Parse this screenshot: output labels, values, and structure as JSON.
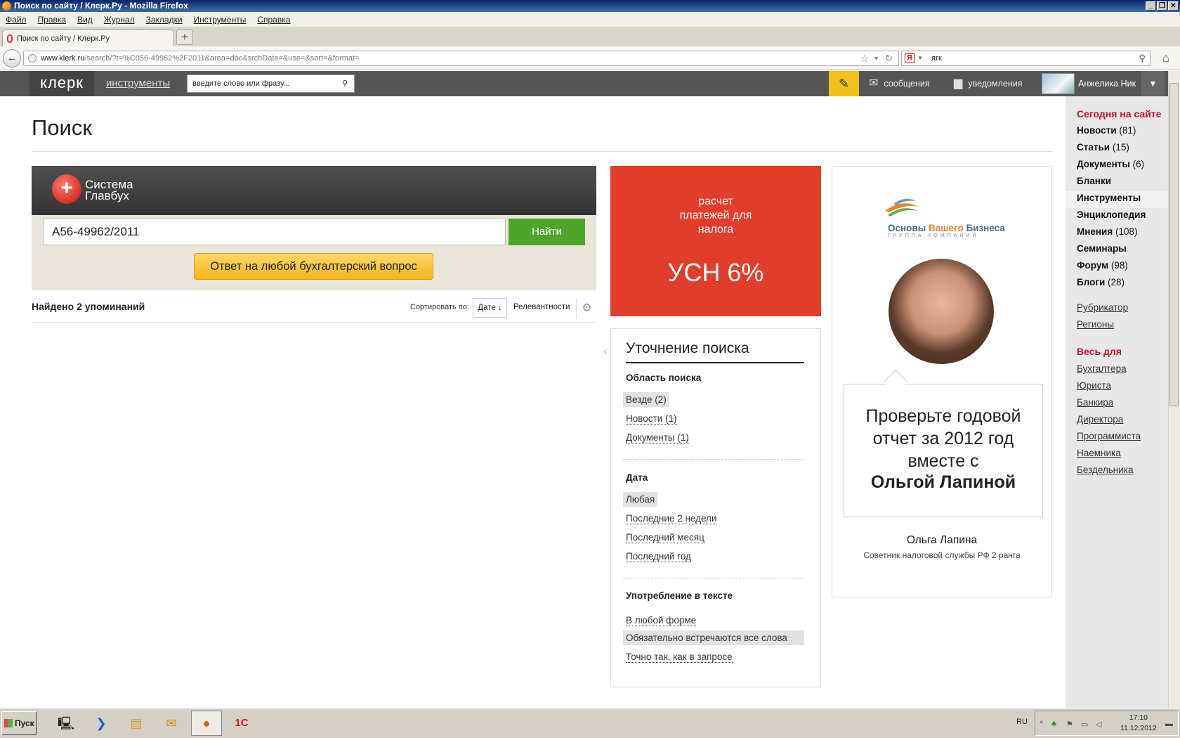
{
  "window": {
    "title": "Поиск по сайту / Клерк.Ру - Mozilla Firefox",
    "buttons": [
      "_",
      "❐",
      "✕"
    ]
  },
  "menu": [
    "Файл",
    "Правка",
    "Вид",
    "Журнал",
    "Закладки",
    "Инструменты",
    "Справка"
  ],
  "tabs": [
    {
      "label": "Поиск по сайту / Клерк.Ру"
    }
  ],
  "newtab_label": "+",
  "nav": {
    "url_domain": "www.klerk.ru",
    "url_path": "/search/?t=%C056-49962%2F2011&area=doc&srchDate=&use=&sort=&format=",
    "search_value": "ягк"
  },
  "site_header": {
    "logo": "клерк",
    "tools_link": "инструменты",
    "search_placeholder": "введите слово или фразу...",
    "messages": "сообщения",
    "notifications": "уведомления",
    "user": "Анжелика Ник"
  },
  "page": {
    "title": "Поиск",
    "glavbukh": {
      "brand_line1": "Система",
      "brand_line2": "Главбух",
      "query_value": "А56-49962/2011",
      "find_button": "Найти",
      "ask_button": "Ответ на любой бухгалтерский вопрос"
    },
    "found": "Найдено 2 упоминаний",
    "sort": {
      "label": "Сортировать по:",
      "by_date": "Дате ↓",
      "by_relevance": "Релевантности"
    }
  },
  "usn_banner": {
    "text": "расчет платежей для налога",
    "big": "УСН 6%"
  },
  "refine": {
    "title": "Уточнение поиска",
    "sections": [
      {
        "heading": "Область поиска",
        "items": [
          {
            "label": "Везде (2)",
            "selected": true
          },
          {
            "label": "Новости (1)",
            "selected": false
          },
          {
            "label": "Документы (1)",
            "selected": false
          }
        ]
      },
      {
        "heading": "Дата",
        "items": [
          {
            "label": "Любая",
            "selected": true
          },
          {
            "label": "Последние 2 недели",
            "selected": false
          },
          {
            "label": "Последний месяц",
            "selected": false
          },
          {
            "label": "Последний год",
            "selected": false
          }
        ]
      },
      {
        "heading": "Употребление в тексте",
        "items": [
          {
            "label": "В любой форме",
            "selected": false
          },
          {
            "label": "Обязательно встречаются все слова",
            "selected": true
          },
          {
            "label": "Точно так, как в запросе",
            "selected": false
          }
        ]
      }
    ]
  },
  "ad": {
    "company_a": "Основы ",
    "company_b": "Вашего",
    "company_c": " Бизнеса",
    "company_sub": "ГРУППА КОМПАНИЙ",
    "headline": "Проверьте годовой отчет за 2012 год вместе с",
    "headline_bold": "Ольгой Лапиной",
    "person": "Ольга Лапина",
    "person_title": "Советник налоговой службы РФ 2 ранга"
  },
  "sidebar": {
    "today_heading": "Сегодня на сайте",
    "today": [
      {
        "name": "Новости",
        "count": "(81)"
      },
      {
        "name": "Статьи",
        "count": "(15)"
      },
      {
        "name": "Документы",
        "count": "(6)"
      },
      {
        "name": "Бланки",
        "count": ""
      },
      {
        "name": "Инструменты",
        "count": ""
      },
      {
        "name": "Энциклопедия",
        "count": ""
      },
      {
        "name": "Мнения",
        "count": "(108)"
      },
      {
        "name": "Семинары",
        "count": ""
      },
      {
        "name": "Форум",
        "count": "(98)"
      },
      {
        "name": "Блоги",
        "count": "(28)"
      }
    ],
    "links": [
      "Рубрикатор",
      "Регионы"
    ],
    "all_heading": "Весь для",
    "roles": [
      "Бухгалтера",
      "Юриста",
      "Банкира",
      "Директора",
      "Программиста",
      "Наемника",
      "Бездельника"
    ]
  },
  "taskbar": {
    "start": "Пуск",
    "lang": "RU",
    "time": "17:10",
    "date": "11.12.2012"
  },
  "icons": {
    "back": "back-arrow-icon",
    "bookmark": "star-icon",
    "reload": "reload-icon",
    "home": "home-icon",
    "site_search": "search-icon",
    "edit": "pencil-icon",
    "messages": "envelope-icon",
    "notifications": "speech-bubble-icon",
    "settings": "gear-icon"
  },
  "colors": {
    "accent_red": "#e23d2b",
    "find_green": "#4ea52a",
    "ask_yellow": "#f3b51a",
    "pencil_yellow": "#f0c21c",
    "sidebar_heading": "#c8102e"
  }
}
